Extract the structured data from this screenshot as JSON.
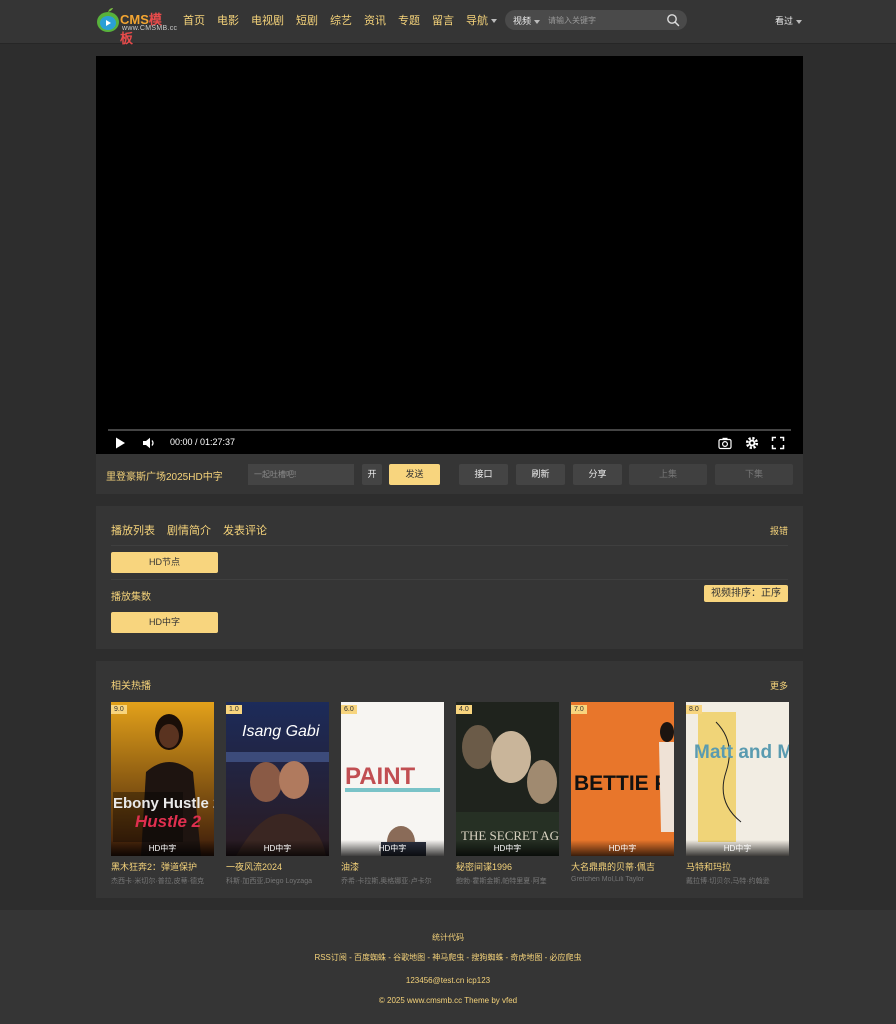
{
  "header": {
    "logo": {
      "main_a": "CMS",
      "main_b": "模板",
      "sub": "www.CMSMB.cc"
    },
    "nav": [
      "首页",
      "电影",
      "电视剧",
      "短剧",
      "综艺",
      "资讯",
      "专题",
      "留言",
      "导航"
    ],
    "search": {
      "type": "视频",
      "placeholder": "请输入关键字"
    },
    "history": "看过"
  },
  "player": {
    "time": "00:00 / 01:27:37"
  },
  "bar": {
    "title": "里登豪斯广场2025HD中字",
    "danmu_placeholder": "一起吐槽吧!",
    "open": "开",
    "send": "发送",
    "api": "接口",
    "refresh": "刷新",
    "share": "分享",
    "prev": "上集",
    "next": "下集"
  },
  "playlist": {
    "tabs": [
      "播放列表",
      "剧情简介",
      "发表评论"
    ],
    "report": "报错",
    "source": "HD节点",
    "episodes_label": "播放集数",
    "sort": "视频排序：正序",
    "episode": "HD中字"
  },
  "related": {
    "title": "相关热播",
    "more": "更多",
    "items": [
      {
        "score": "9.0",
        "quality": "HD中字",
        "title": "黑木狂奔2：弹道保护",
        "cast": "杰西卡·米切尔·普拉,皮蒂·德克",
        "poster_text": "Ebony Hustle 2"
      },
      {
        "score": "1.0",
        "quality": "HD中字",
        "title": "一夜风流2024",
        "cast": "科斯·加西亚,Diego Loyzaga",
        "poster_text": "Isang Gabi"
      },
      {
        "score": "6.0",
        "quality": "HD中字",
        "title": "油漆",
        "cast": "乔希·卡拉斯,奥格娜亚·卢卡尔",
        "poster_text": "PAINT"
      },
      {
        "score": "4.0",
        "quality": "HD中字",
        "title": "秘密间谍1996",
        "cast": "鲍勃·霍斯金斯,帕特里夏·阿奎",
        "poster_text": "THE SECRET AGENT"
      },
      {
        "score": "7.0",
        "quality": "HD中字",
        "title": "大名鼎鼎的贝蒂·佩吉",
        "cast": "Gretchen Mol,Lili Taylor",
        "poster_text": "BETTIE PAGE"
      },
      {
        "score": "8.0",
        "quality": "HD中字",
        "title": "马特和玛拉",
        "cast": "戴拉博·切贝尔,马特·约翰逊",
        "poster_text": "Matt and Mara"
      }
    ]
  },
  "footer": {
    "stats": "统计代码",
    "links": "RSS订阅 - 百度蜘蛛 - 谷歌地图 - 神马爬虫 - 搜狗蜘蛛 - 奇虎地图 - 必应爬虫",
    "contact": "123456@test.cn   icp123",
    "copyright": "© 2025 www.cmsmb.cc Theme by vfed"
  }
}
